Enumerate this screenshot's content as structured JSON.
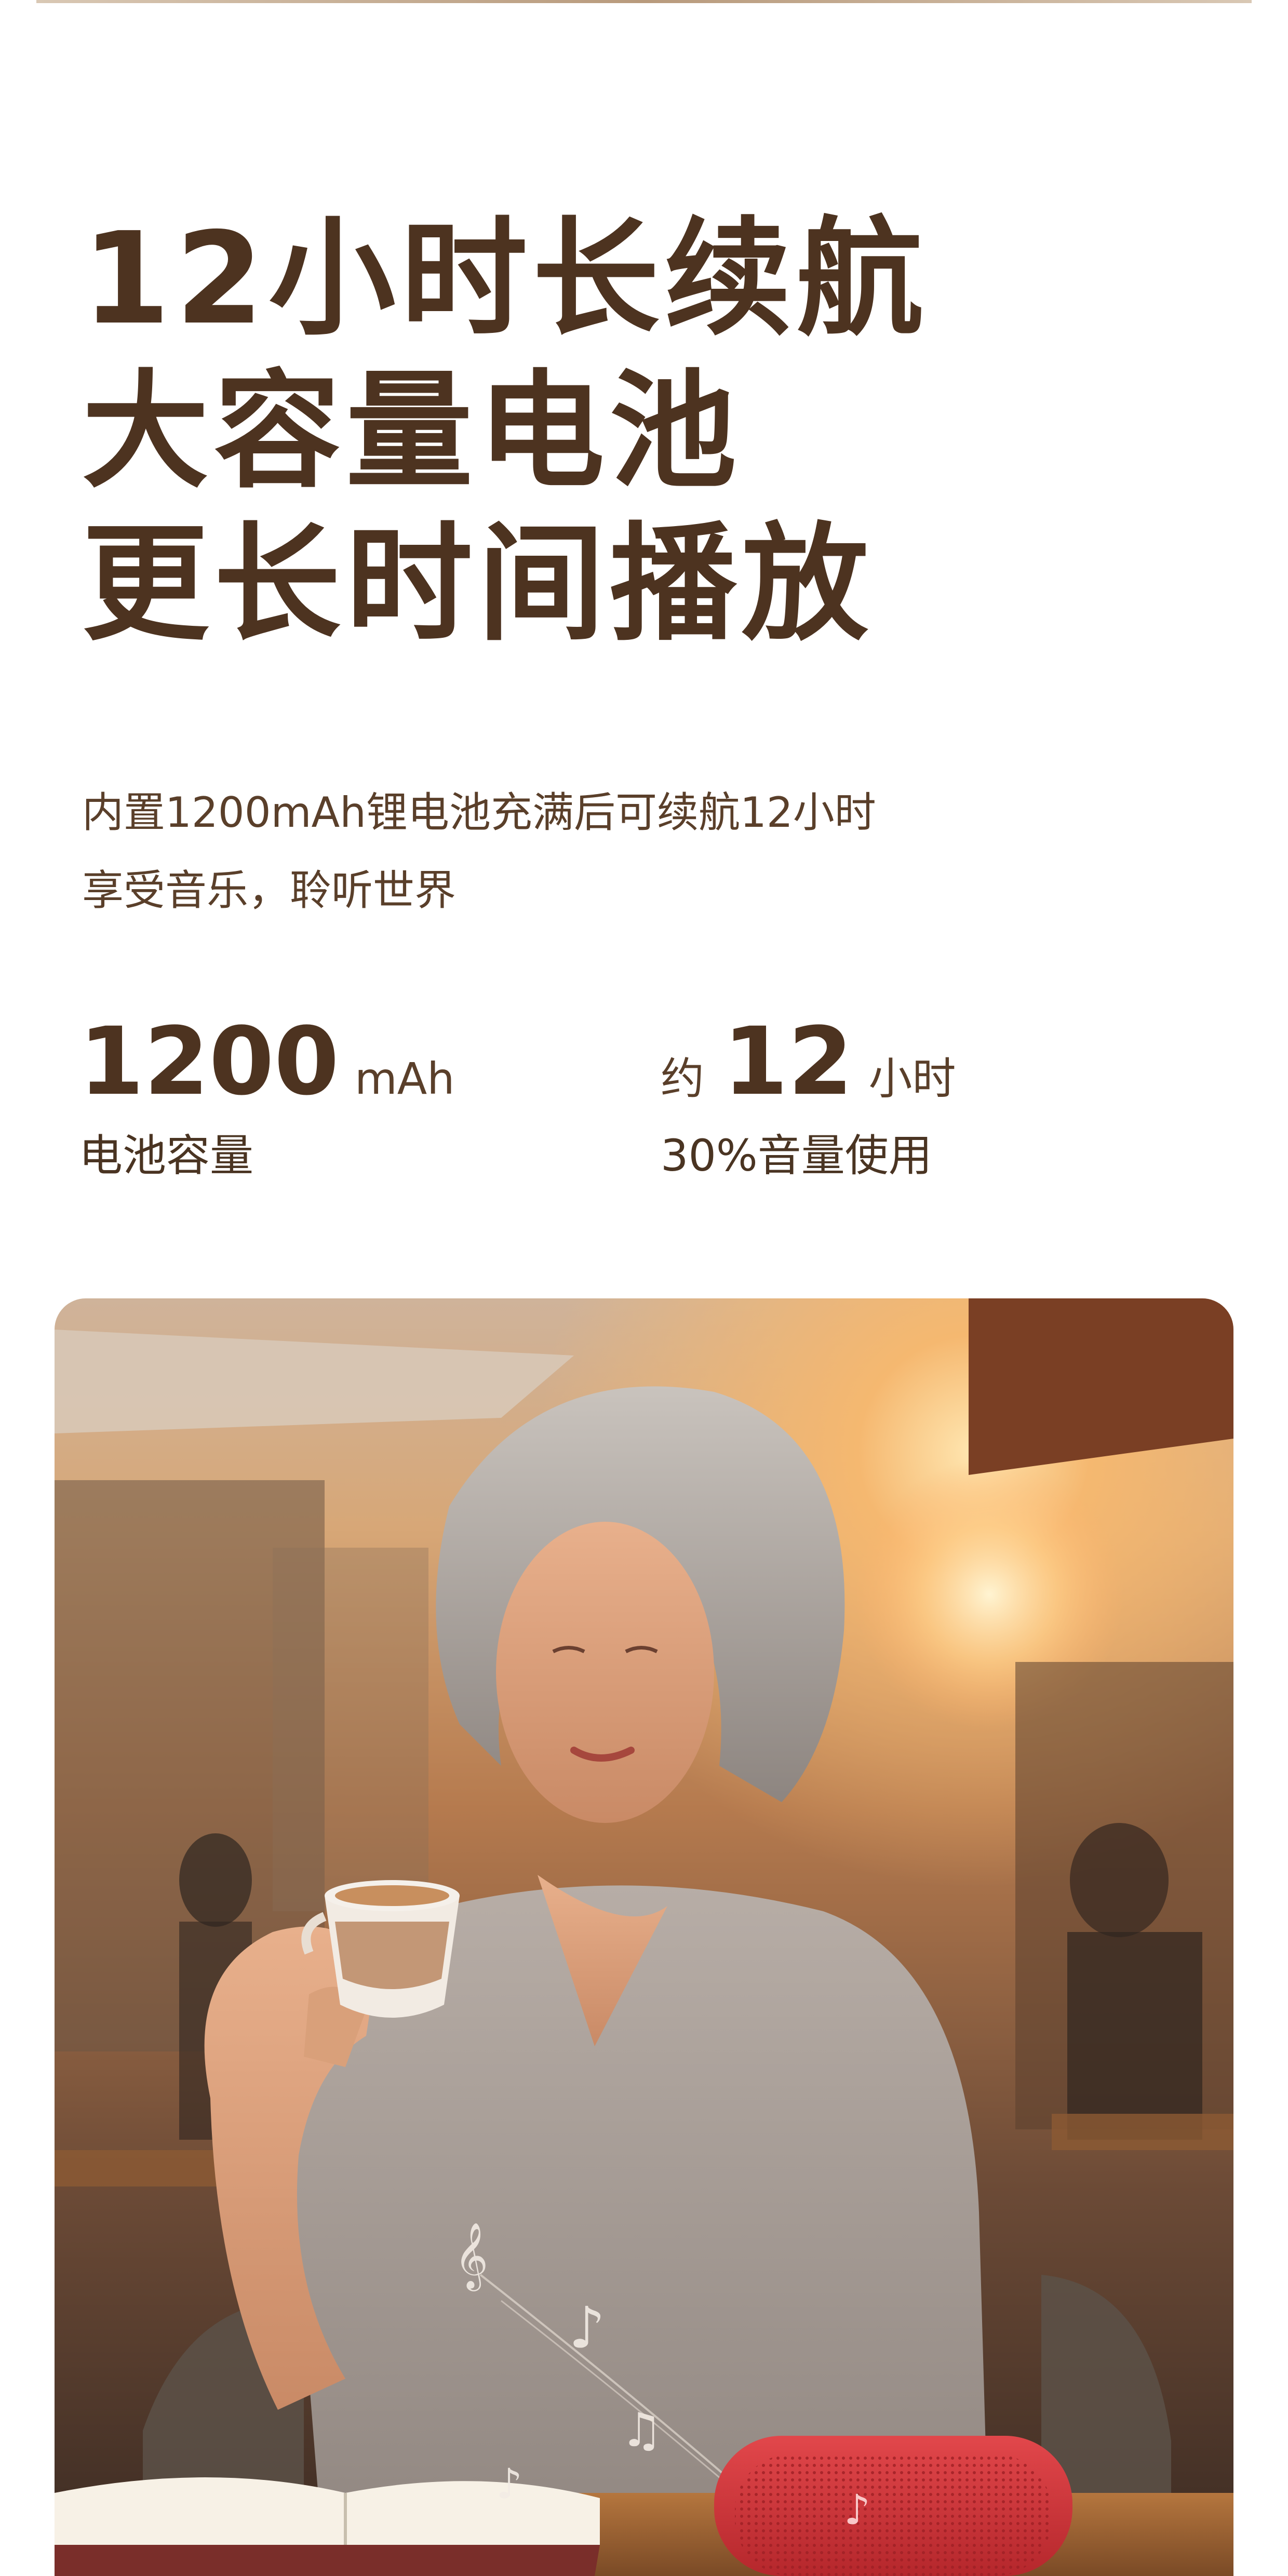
{
  "headline": {
    "line1": "12小时长续航",
    "line2": "大容量电池",
    "line3": "更长时间播放"
  },
  "subtitle": {
    "line1": "内置1200mAh锂电池充满后可续航12小时",
    "line2": "享受音乐，聆听世界"
  },
  "stats": [
    {
      "prefix": "",
      "value": "1200",
      "unit": "mAh",
      "label": "电池容量"
    },
    {
      "prefix": "约",
      "value": "12",
      "unit": "小时",
      "label": "30%音量使用"
    }
  ],
  "photo": {
    "subject": "elderly-woman-drinking-coffee-at-outdoor-cafe-with-red-speaker",
    "accent_color": "#d9343a",
    "sunset_color": "#f5b870"
  },
  "colors": {
    "headline": "#4d3320",
    "body_text": "#5a3f2a",
    "background": "#ffffff"
  }
}
